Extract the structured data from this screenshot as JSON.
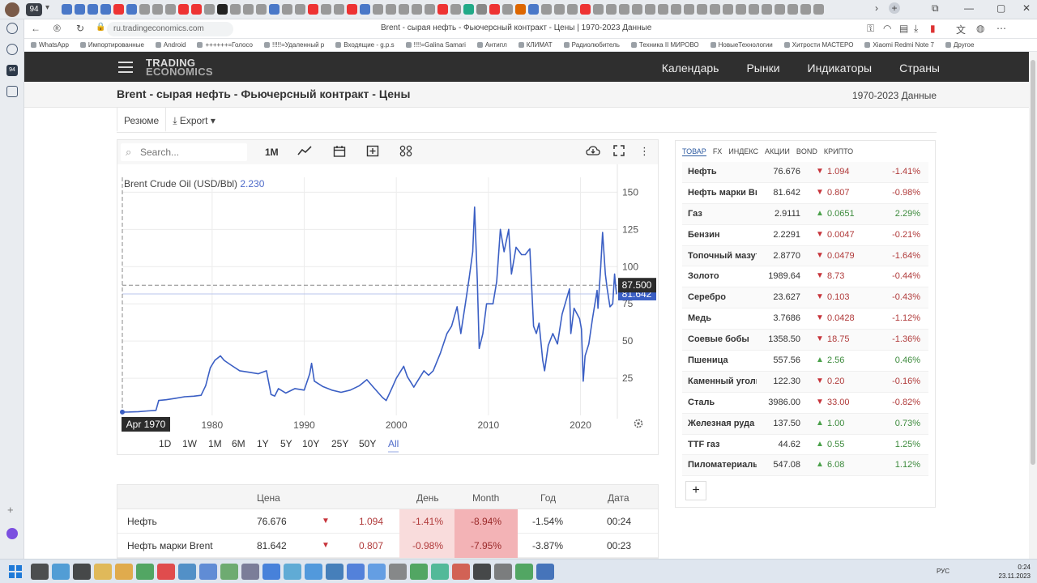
{
  "browser": {
    "tab_counter": "94",
    "url": "ru.tradingeconomics.com",
    "page_title": "Brent - сырая нефть - Фьючерсный контракт - Цены | 1970-2023 Данные",
    "bookmarks": [
      "WhatsApp",
      "Импортированные",
      "Android",
      "++++++=Голосо",
      "!!!!!=Удаленный р",
      "Входящие - g.p.s",
      "!!!!=Galina Samari",
      "Антипл",
      "КЛИМАТ",
      "Радиолюбитель",
      "Техника II МИРОВО",
      "НовыеТехнологии",
      "Хитрости МАСТЕРО",
      "Xiaomi Redmi Note 7",
      "Другое"
    ]
  },
  "site": {
    "logo_line1": "TRADING",
    "logo_line2": "ECONOMICS",
    "menu": [
      "Календарь",
      "Рынки",
      "Индикаторы",
      "Страны"
    ],
    "heading": "Brent - сырая нефть - Фьючерсный контракт - Цены",
    "data_range": "1970-2023 Данные",
    "tabs": {
      "summary": "Резюме",
      "export": "Export"
    }
  },
  "chart_toolbar": {
    "search_placeholder": "Search...",
    "interval": "1M"
  },
  "chart_data": {
    "type": "line",
    "title": "Brent Crude Oil (USD/Bbl)",
    "title_value": "2.230",
    "xlabel": "",
    "ylabel": "",
    "x_ticks": [
      "1980",
      "1990",
      "2000",
      "2010",
      "2020"
    ],
    "y_ticks": [
      25,
      50,
      75,
      100,
      125,
      150
    ],
    "xlim": [
      1970.25,
      2024.0
    ],
    "ylim": [
      0,
      160
    ],
    "grid": true,
    "crosshair_label": "Apr 1970",
    "crosshair_value": "87.500",
    "last_value": "81.642",
    "series": [
      {
        "color": "#3b5fc4",
        "points": [
          [
            1970.25,
            2.23
          ],
          [
            1971.0,
            2.3
          ],
          [
            1972.0,
            2.5
          ],
          [
            1973.0,
            3.0
          ],
          [
            1973.9,
            3.4
          ],
          [
            1974.2,
            10.0
          ],
          [
            1975.0,
            10.5
          ],
          [
            1976.0,
            11.5
          ],
          [
            1977.0,
            12.5
          ],
          [
            1978.0,
            12.9
          ],
          [
            1978.8,
            13.5
          ],
          [
            1979.3,
            20.0
          ],
          [
            1979.8,
            32.0
          ],
          [
            1980.3,
            37.0
          ],
          [
            1980.9,
            40.0
          ],
          [
            1981.3,
            37.0
          ],
          [
            1982.0,
            34.0
          ],
          [
            1983.0,
            30.0
          ],
          [
            1984.0,
            29.0
          ],
          [
            1985.0,
            28.0
          ],
          [
            1985.9,
            30.0
          ],
          [
            1986.4,
            14.0
          ],
          [
            1986.8,
            13.0
          ],
          [
            1987.2,
            18.0
          ],
          [
            1988.0,
            15.0
          ],
          [
            1989.0,
            18.0
          ],
          [
            1990.0,
            17.0
          ],
          [
            1990.6,
            28.0
          ],
          [
            1990.8,
            35.0
          ],
          [
            1991.1,
            23.0
          ],
          [
            1992.0,
            19.5
          ],
          [
            1993.0,
            17.0
          ],
          [
            1994.0,
            15.5
          ],
          [
            1995.0,
            17.0
          ],
          [
            1996.0,
            20.0
          ],
          [
            1996.8,
            24.0
          ],
          [
            1997.5,
            19.0
          ],
          [
            1998.5,
            12.0
          ],
          [
            1998.9,
            10.0
          ],
          [
            1999.5,
            18.0
          ],
          [
            2000.0,
            25.0
          ],
          [
            2000.8,
            33.0
          ],
          [
            2001.2,
            26.0
          ],
          [
            2001.9,
            19.0
          ],
          [
            2002.5,
            25.0
          ],
          [
            2003.0,
            30.0
          ],
          [
            2003.5,
            27.0
          ],
          [
            2004.0,
            30.0
          ],
          [
            2004.8,
            42.0
          ],
          [
            2005.5,
            55.0
          ],
          [
            2006.0,
            60.0
          ],
          [
            2006.6,
            73.0
          ],
          [
            2007.0,
            55.0
          ],
          [
            2007.5,
            75.0
          ],
          [
            2007.9,
            92.0
          ],
          [
            2008.3,
            110.0
          ],
          [
            2008.5,
            140.0
          ],
          [
            2008.8,
            90.0
          ],
          [
            2009.0,
            45.0
          ],
          [
            2009.4,
            55.0
          ],
          [
            2009.8,
            75.0
          ],
          [
            2010.5,
            75.0
          ],
          [
            2010.9,
            90.0
          ],
          [
            2011.3,
            125.0
          ],
          [
            2011.7,
            110.0
          ],
          [
            2012.2,
            125.0
          ],
          [
            2012.5,
            95.0
          ],
          [
            2013.0,
            113.0
          ],
          [
            2013.6,
            108.0
          ],
          [
            2014.0,
            108.0
          ],
          [
            2014.5,
            112.0
          ],
          [
            2014.9,
            60.0
          ],
          [
            2015.2,
            55.0
          ],
          [
            2015.5,
            62.0
          ],
          [
            2015.9,
            37.0
          ],
          [
            2016.1,
            30.0
          ],
          [
            2016.5,
            47.0
          ],
          [
            2017.0,
            55.0
          ],
          [
            2017.5,
            48.0
          ],
          [
            2018.0,
            68.0
          ],
          [
            2018.8,
            85.0
          ],
          [
            2018.95,
            55.0
          ],
          [
            2019.3,
            72.0
          ],
          [
            2019.9,
            65.0
          ],
          [
            2020.1,
            58.0
          ],
          [
            2020.3,
            23.0
          ],
          [
            2020.5,
            40.0
          ],
          [
            2020.9,
            48.0
          ],
          [
            2021.3,
            65.0
          ],
          [
            2021.8,
            84.0
          ],
          [
            2021.9,
            72.0
          ],
          [
            2022.2,
            100.0
          ],
          [
            2022.4,
            123.0
          ],
          [
            2022.7,
            95.0
          ],
          [
            2022.9,
            85.0
          ],
          [
            2023.2,
            73.0
          ],
          [
            2023.5,
            75.0
          ],
          [
            2023.7,
            95.0
          ],
          [
            2023.8,
            88.0
          ],
          [
            2023.9,
            81.642
          ]
        ]
      }
    ]
  },
  "range_buttons": [
    "1D",
    "1W",
    "1M",
    "6M",
    "1Y",
    "5Y",
    "10Y",
    "25Y",
    "50Y",
    "All"
  ],
  "range_active": "All",
  "market": {
    "tabs": [
      "ТОВАР",
      "FX",
      "ИНДЕКС",
      "АКЦИИ",
      "BOND",
      "КРИПТО"
    ],
    "rows": [
      {
        "name": "Нефть",
        "price": "76.676",
        "dir": "down",
        "change": "1.094",
        "pct": "-1.41%"
      },
      {
        "name": "Нефть марки Brent",
        "price": "81.642",
        "dir": "down",
        "change": "0.807",
        "pct": "-0.98%"
      },
      {
        "name": "Газ",
        "price": "2.9111",
        "dir": "up",
        "change": "0.0651",
        "pct": "2.29%"
      },
      {
        "name": "Бензин",
        "price": "2.2291",
        "dir": "down",
        "change": "0.0047",
        "pct": "-0.21%"
      },
      {
        "name": "Топочный мазут",
        "price": "2.8770",
        "dir": "down",
        "change": "0.0479",
        "pct": "-1.64%"
      },
      {
        "name": "Золото",
        "price": "1989.64",
        "dir": "down",
        "change": "8.73",
        "pct": "-0.44%"
      },
      {
        "name": "Серебро",
        "price": "23.627",
        "dir": "down",
        "change": "0.103",
        "pct": "-0.43%"
      },
      {
        "name": "Медь",
        "price": "3.7686",
        "dir": "down",
        "change": "0.0428",
        "pct": "-1.12%"
      },
      {
        "name": "Соевые бобы",
        "price": "1358.50",
        "dir": "down",
        "change": "18.75",
        "pct": "-1.36%"
      },
      {
        "name": "Пшеница",
        "price": "557.56",
        "dir": "up",
        "change": "2.56",
        "pct": "0.46%"
      },
      {
        "name": "Каменный уголь",
        "price": "122.30",
        "dir": "down",
        "change": "0.20",
        "pct": "-0.16%"
      },
      {
        "name": "Сталь",
        "price": "3986.00",
        "dir": "down",
        "change": "33.00",
        "pct": "-0.82%"
      },
      {
        "name": "Железная руда",
        "price": "137.50",
        "dir": "up",
        "change": "1.00",
        "pct": "0.73%"
      },
      {
        "name": "TTF газ",
        "price": "44.62",
        "dir": "up",
        "change": "0.55",
        "pct": "1.25%"
      },
      {
        "name": "Пиломатериалы",
        "price": "547.08",
        "dir": "up",
        "change": "6.08",
        "pct": "1.12%"
      }
    ],
    "add_label": "+"
  },
  "table": {
    "headers": {
      "price": "Цена",
      "day": "День",
      "month": "Month",
      "year": "Год",
      "date": "Дата"
    },
    "rows": [
      {
        "name": "Нефть",
        "price": "76.676",
        "change": "1.094",
        "day": "-1.41%",
        "month": "-8.94%",
        "year": "-1.54%",
        "date": "00:24"
      },
      {
        "name": "Нефть марки Brent",
        "price": "81.642",
        "change": "0.807",
        "day": "-0.98%",
        "month": "-7.95%",
        "year": "-3.87%",
        "date": "00:23"
      }
    ]
  },
  "taskbar": {
    "lang": "РУС",
    "time": "0:24",
    "date": "23.11.2023"
  },
  "colors": {
    "accent": "#4f6bc9",
    "line": "#3b5fc4",
    "down": "#c7333a",
    "up": "#4aa14a",
    "nav_bg": "#2f2f2f"
  }
}
